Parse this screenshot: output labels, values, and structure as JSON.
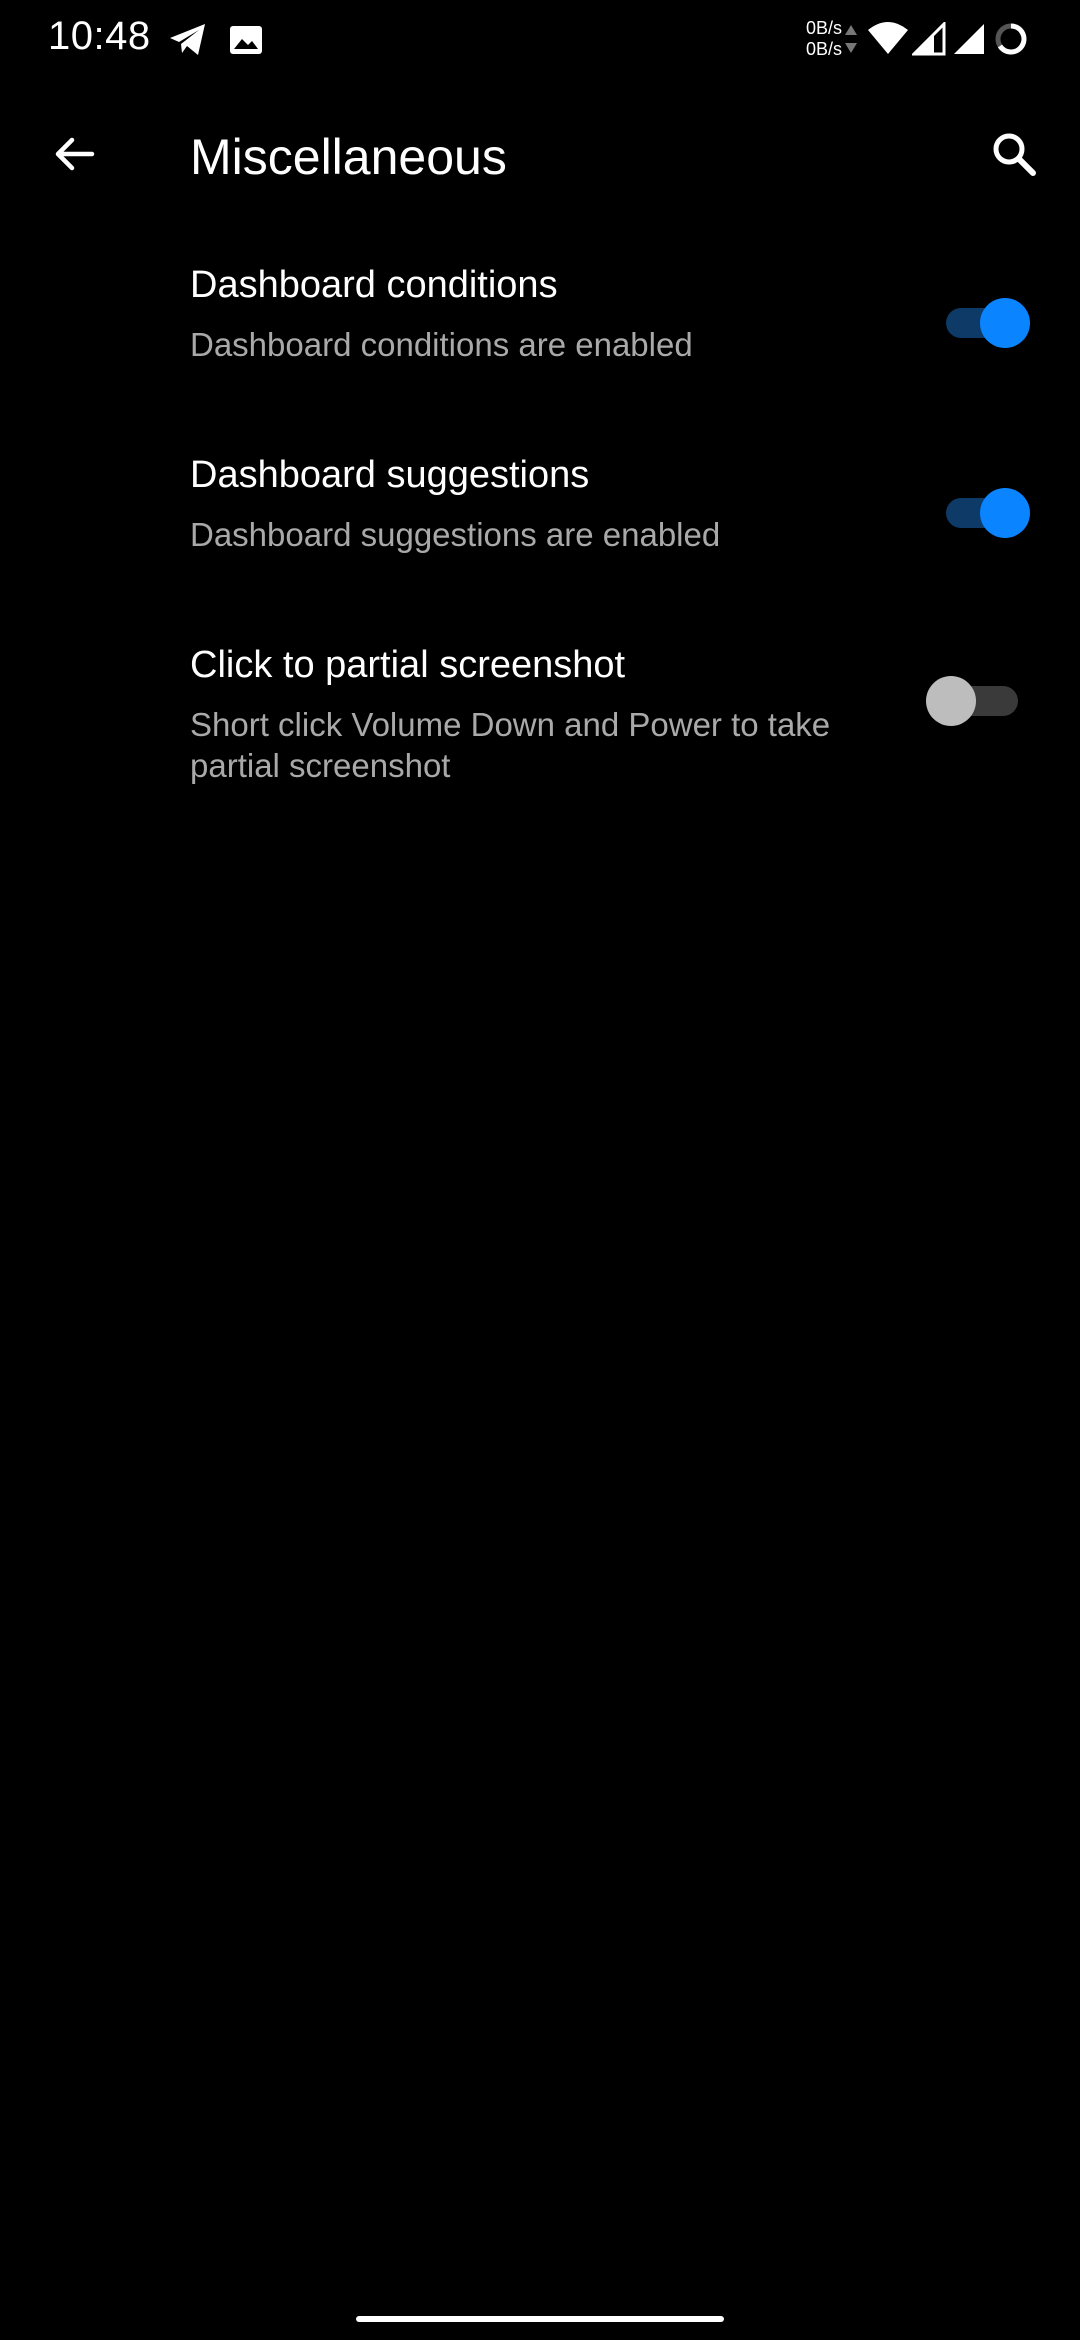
{
  "status_bar": {
    "time": "10:48",
    "net_up": "0B/s",
    "net_down": "0B/s",
    "icons": [
      "telegram-icon",
      "gallery-icon",
      "data-activity-icon",
      "wifi-icon",
      "signal-icon",
      "signal-icon",
      "battery-icon"
    ]
  },
  "app_bar": {
    "title": "Miscellaneous",
    "back_icon": "arrow-back-icon",
    "search_icon": "search-icon"
  },
  "settings": [
    {
      "title": "Dashboard conditions",
      "summary": "Dashboard conditions are enabled",
      "enabled": true
    },
    {
      "title": "Dashboard suggestions",
      "summary": "Dashboard suggestions are enabled",
      "enabled": true
    },
    {
      "title": "Click to partial screenshot",
      "summary": "Short click Volume Down and Power to take partial screenshot",
      "enabled": false
    }
  ],
  "colors": {
    "background": "#000000",
    "accent": "#0a84ff",
    "accent_track": "#0d3a66",
    "summary_text": "#a9a9a9",
    "switch_off_thumb": "#bdbdbd",
    "switch_off_track": "#3a3a3a"
  }
}
